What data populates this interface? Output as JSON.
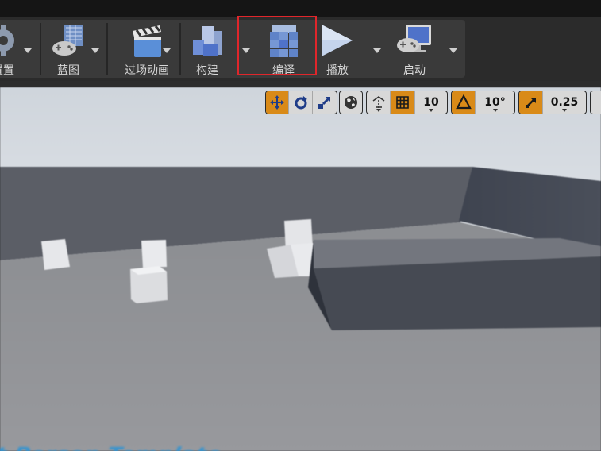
{
  "toolbar": {
    "buttons": [
      {
        "label": "置置",
        "icon": "settings-gear-icon"
      },
      {
        "label": "蓝图",
        "icon": "blueprint-gamepad-icon"
      },
      {
        "label": "过场动画",
        "icon": "cinematics-clapper-icon"
      },
      {
        "label": "构建",
        "icon": "build-blocks-icon"
      },
      {
        "label": "编译",
        "icon": "compile-cubes-icon"
      },
      {
        "label": "播放",
        "icon": "play-triangle-icon"
      },
      {
        "label": "启动",
        "icon": "launch-monitor-icon"
      }
    ]
  },
  "viewport_toolbar": {
    "translate_active": true,
    "grid_snap_value": "10",
    "rotation_snap_value": "10°",
    "scale_snap_value": "0.25"
  },
  "viewport": {
    "floor_text": "st Person Template"
  },
  "colors": {
    "accent": "#d98a18",
    "highlight": "#e0262b",
    "floor_text": "#2a93d5"
  }
}
